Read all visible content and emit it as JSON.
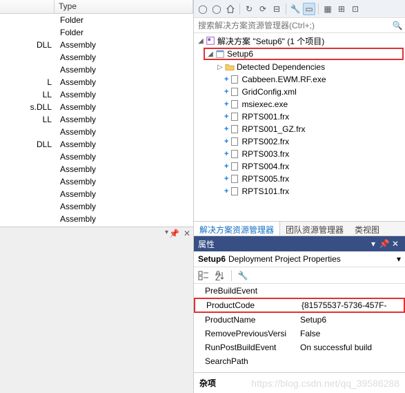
{
  "file_list": {
    "header_name": "",
    "header_type": "Type",
    "rows": [
      {
        "name": "",
        "type": "Folder"
      },
      {
        "name": "",
        "type": "Folder"
      },
      {
        "name": "DLL",
        "type": "Assembly"
      },
      {
        "name": "",
        "type": "Assembly"
      },
      {
        "name": "",
        "type": "Assembly"
      },
      {
        "name": "L",
        "type": "Assembly"
      },
      {
        "name": "LL",
        "type": "Assembly"
      },
      {
        "name": "s.DLL",
        "type": "Assembly"
      },
      {
        "name": "LL",
        "type": "Assembly"
      },
      {
        "name": "",
        "type": "Assembly"
      },
      {
        "name": "DLL",
        "type": "Assembly"
      },
      {
        "name": "",
        "type": "Assembly"
      },
      {
        "name": "",
        "type": "Assembly"
      },
      {
        "name": "",
        "type": "Assembly"
      },
      {
        "name": "",
        "type": "Assembly"
      },
      {
        "name": "",
        "type": "Assembly"
      },
      {
        "name": "",
        "type": "Assembly"
      }
    ]
  },
  "search": {
    "placeholder": "搜索解决方案资源管理器(Ctrl+;)"
  },
  "solution": {
    "root": "解决方案 \"Setup6\" (1 个项目)",
    "project": "Setup6",
    "detected": "Detected Dependencies",
    "files": [
      "Cabbeen.EWM.RF.exe",
      "GridConfig.xml",
      "msiexec.exe",
      "RPTS001.frx",
      "RPTS001_GZ.frx",
      "RPTS002.frx",
      "RPTS003.frx",
      "RPTS004.frx",
      "RPTS005.frx",
      "RPTS101.frx"
    ]
  },
  "tabs": {
    "t1": "解决方案资源管理器",
    "t2": "团队资源管理器",
    "t3": "类视图"
  },
  "props": {
    "title": "属性",
    "subtitle_bold": "Setup6",
    "subtitle_rest": "Deployment Project Properties",
    "rows": [
      {
        "name": "PreBuildEvent",
        "val": ""
      },
      {
        "name": "ProductCode",
        "val": "{81575537-5736-457F-",
        "hl": true
      },
      {
        "name": "ProductName",
        "val": "Setup6"
      },
      {
        "name": "RemovePreviousVersi",
        "val": "False"
      },
      {
        "name": "RunPostBuildEvent",
        "val": "On successful build"
      },
      {
        "name": "SearchPath",
        "val": ""
      }
    ],
    "footer": "杂项"
  },
  "watermark": "https://blog.csdn.net/qq_39586288"
}
